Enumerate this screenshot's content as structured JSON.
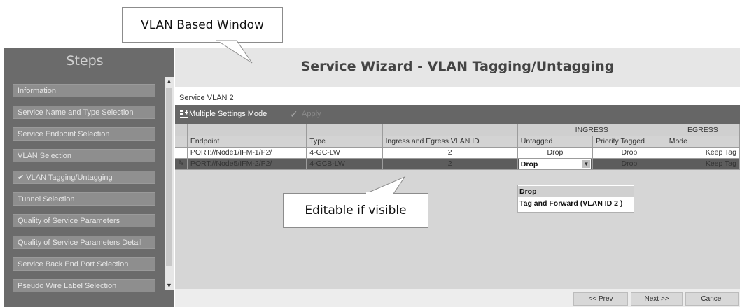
{
  "callouts": {
    "top": "VLAN Based Window",
    "middle": "Editable if visible"
  },
  "steps": {
    "title": "Steps",
    "items": [
      {
        "label": "Information",
        "active": false
      },
      {
        "label": "Service Name and Type Selection",
        "active": false
      },
      {
        "label": "Service Endpoint Selection",
        "active": false
      },
      {
        "label": "VLAN Selection",
        "active": false
      },
      {
        "label": "✔ VLAN Tagging/Untagging",
        "active": true
      },
      {
        "label": "Tunnel Selection",
        "active": false
      },
      {
        "label": "Quality of Service Parameters",
        "active": false
      },
      {
        "label": "Quality of Service Parameters Detail",
        "active": false
      },
      {
        "label": "Service Back End Port Selection",
        "active": false
      },
      {
        "label": "Pseudo Wire Label Selection",
        "active": false
      }
    ]
  },
  "wizard": {
    "title": "Service Wizard - VLAN Tagging/Untagging",
    "service_label": "Service VLAN 2",
    "toolbar": {
      "multi_settings": "Multiple Settings Mode",
      "apply": "Apply"
    },
    "groups": {
      "ingress": "INGRESS",
      "egress": "EGRESS"
    },
    "columns": {
      "endpoint": "Endpoint",
      "type": "Type",
      "vlan_id": "Ingress and Egress VLAN ID",
      "untagged": "Untagged",
      "priority_tagged": "Priority Tagged",
      "mode": "Mode"
    },
    "rows": [
      {
        "marker": "",
        "endpoint": "PORT://Node1/IFM-1/P2/",
        "type": "4-GC-LW",
        "vlan_id": "2",
        "untagged": "Drop",
        "priority_tagged": "Drop",
        "mode": "Keep Tag"
      },
      {
        "marker": "✎",
        "endpoint": "PORT://Node5/IFM-2/P2/",
        "type": "4-GCB-LW",
        "vlan_id": "2",
        "untagged": "Drop",
        "priority_tagged": "Drop",
        "mode": "Keep Tag"
      }
    ],
    "dropdown_options": [
      "Drop",
      "Tag and Forward (VLAN ID 2 )"
    ],
    "buttons": {
      "prev": "<< Prev",
      "next": "Next >>",
      "cancel": "Cancel"
    }
  },
  "colors": {
    "steps_bg": "#6b6b6b",
    "toolbar_bg": "#666666",
    "selected_row_bg": "#5d5d5d",
    "grid_bg": "#d6d6d6"
  }
}
